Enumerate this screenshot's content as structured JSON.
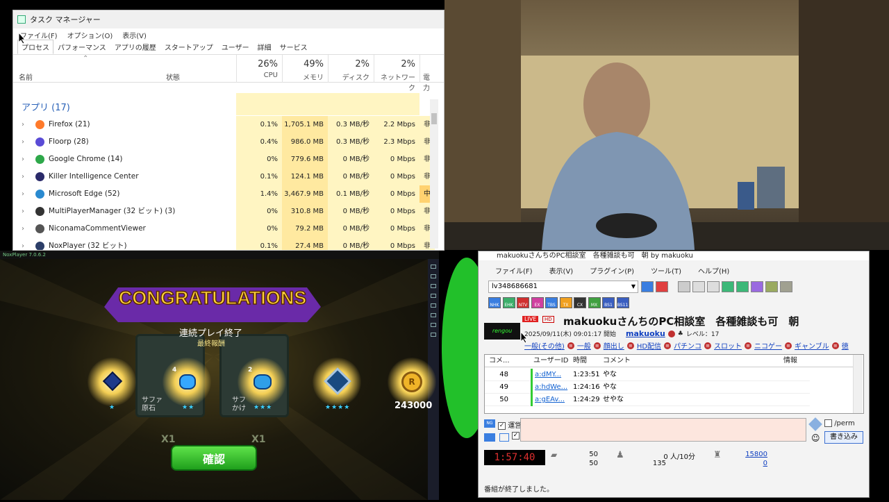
{
  "taskmgr": {
    "title": "タスク マネージャー",
    "menu": [
      "ファイル(F)",
      "オプション(O)",
      "表示(V)"
    ],
    "tabs": [
      "プロセス",
      "パフォーマンス",
      "アプリの履歴",
      "スタートアップ",
      "ユーザー",
      "詳細",
      "サービス"
    ],
    "col_name": "名前",
    "col_status": "状態",
    "cpu": {
      "pct": "26%",
      "label": "CPU"
    },
    "mem": {
      "pct": "49%",
      "label": "メモリ"
    },
    "disk": {
      "pct": "2%",
      "label": "ディスク"
    },
    "net": {
      "pct": "2%",
      "label": "ネットワーク"
    },
    "power": {
      "label": "電力"
    },
    "group": "アプリ (17)",
    "rows": [
      {
        "name": "Firefox (21)",
        "cpu": "0.1%",
        "mem": "1,705.1 MB",
        "disk": "0.3 MB/秒",
        "net": "2.2 Mbps",
        "power": "非"
      },
      {
        "name": "Floorp (28)",
        "cpu": "0.4%",
        "mem": "986.0 MB",
        "disk": "0.3 MB/秒",
        "net": "2.3 Mbps",
        "power": "非"
      },
      {
        "name": "Google Chrome (14)",
        "cpu": "0%",
        "mem": "779.6 MB",
        "disk": "0 MB/秒",
        "net": "0 Mbps",
        "power": "非"
      },
      {
        "name": "Killer Intelligence Center",
        "cpu": "0.1%",
        "mem": "124.1 MB",
        "disk": "0 MB/秒",
        "net": "0 Mbps",
        "power": "非"
      },
      {
        "name": "Microsoft Edge (52)",
        "cpu": "1.4%",
        "mem": "3,467.9 MB",
        "disk": "0.1 MB/秒",
        "net": "0 Mbps",
        "power": "中"
      },
      {
        "name": "MultiPlayerManager (32 ビット) (3)",
        "cpu": "0%",
        "mem": "310.8 MB",
        "disk": "0 MB/秒",
        "net": "0 Mbps",
        "power": "非"
      },
      {
        "name": "NiconamaCommentViewer",
        "cpu": "0%",
        "mem": "79.2 MB",
        "disk": "0 MB/秒",
        "net": "0 Mbps",
        "power": "非"
      },
      {
        "name": "NoxPlayer (32 ビット)",
        "cpu": "0.1%",
        "mem": "27.4 MB",
        "disk": "0 MB/秒",
        "net": "0 Mbps",
        "power": "非"
      }
    ]
  },
  "game": {
    "window_title": "NoxPlayer 7.0.6.2",
    "banner": "CONGRATULATIONS",
    "heading": "連続プレイ終了",
    "subheading": "最終報酬",
    "card1": "サファ\n原石",
    "card2": "サフ\nかけ",
    "count_a": "4",
    "count_b": "2",
    "coin_amount": "243000",
    "star_row": [
      "★",
      "★★",
      "★★★",
      "★★★★"
    ],
    "x1": "X1",
    "confirm": "確認"
  },
  "ncv": {
    "title": "makuokuさんちのPC相談室　各種雑談も可　朝 by makuoku",
    "menu": [
      "ファイル(F)",
      "表示(V)",
      "プラグイン(P)",
      "ツール(T)",
      "ヘルプ(H)"
    ],
    "live_id": "lv348686681",
    "channel_icons": [
      "NHK",
      "EHK",
      "NTV",
      "EX",
      "TBS",
      "TX",
      "CX",
      "MX",
      "BS1",
      "BS11"
    ],
    "thumb_label": "rengou",
    "live_badge": "LIVE",
    "hd_badge": "HD",
    "program_title": "makuokuさんちのPC相談室　各種雑談も可　朝",
    "start": "2025/09/11(木) 09:01:17 開始",
    "owner": "makuoku",
    "level": "レベル：17",
    "categories": [
      "一般(その他)",
      "一般",
      "顔出し",
      "HD配信",
      "パチンコ",
      "スロット",
      "ニコゲー",
      "ギャンブル",
      "徳"
    ],
    "grid_headers": [
      "コメ...",
      "ユーザーID",
      "時間",
      "コメント",
      "情報"
    ],
    "comments": [
      {
        "no": "48",
        "uid": "a:dMY...",
        "time": "1:23:51",
        "text": "やな"
      },
      {
        "no": "49",
        "uid": "a:hdWe...",
        "time": "1:24:16",
        "text": "やな"
      },
      {
        "no": "50",
        "uid": "a:gEAv...",
        "time": "1:24:29",
        "text": "せやな"
      }
    ],
    "unei": "運営",
    "perm": "/perm",
    "write_button": "書き込み",
    "timer": "1:57:40",
    "comment_count_1": "50",
    "comment_count_2": "50",
    "viewers_rate": "0 人/10分",
    "viewers_total": "135",
    "points": "15800",
    "points2": "0",
    "status": "番組が終了しました。"
  }
}
